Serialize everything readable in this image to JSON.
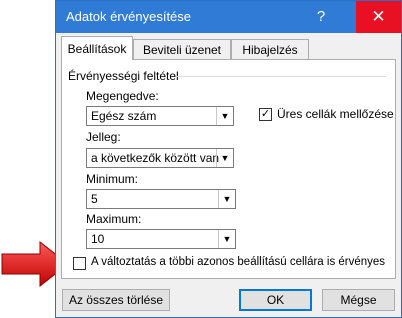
{
  "window": {
    "title": "Adatok érvényesítése",
    "help_label": "?",
    "close_label": "✕"
  },
  "tabs": [
    {
      "label": "Beállítások",
      "active": true
    },
    {
      "label": "Beviteli üzenet",
      "active": false
    },
    {
      "label": "Hibajelzés",
      "active": false
    }
  ],
  "criteria": {
    "group_title": "Érvényességi feltétel",
    "allow_label": "Megengedve:",
    "allow_value": "Egész szám",
    "ignore_blank_label": "Üres cellák mellőzése",
    "ignore_blank_checked": true,
    "data_label": "Jelleg:",
    "data_value": "a következők között van",
    "min_label": "Minimum:",
    "min_value": "5",
    "max_label": "Maximum:",
    "max_value": "10"
  },
  "apply_all": {
    "label": "A változtatás a többi azonos beállítású cellára is érvényes",
    "checked": false
  },
  "buttons": {
    "clear_all": "Az összes törlése",
    "ok": "OK",
    "cancel": "Mégse"
  },
  "icons": {
    "callout": "red-pointer-arrow-icon",
    "check": "✓",
    "dropdown": "▼"
  },
  "colors": {
    "titlebar": "#2f7bd6",
    "close": "#e81123",
    "accent": "#0078d7",
    "arrow": "#e01010"
  }
}
